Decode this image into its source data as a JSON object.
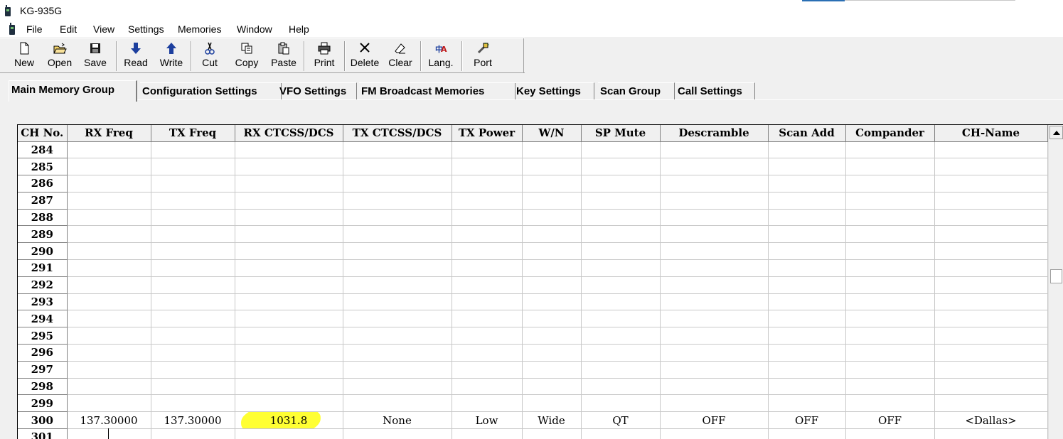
{
  "window": {
    "title": "KG-935G"
  },
  "menu": [
    "File",
    "Edit",
    "View",
    "Settings",
    "Memories",
    "Window",
    "Help"
  ],
  "toolbar": [
    {
      "label": "New",
      "icon": "new-file-icon"
    },
    {
      "label": "Open",
      "icon": "open-folder-icon"
    },
    {
      "label": "Save",
      "icon": "floppy-disk-icon"
    },
    {
      "label": "Read",
      "icon": "arrow-down-icon"
    },
    {
      "label": "Write",
      "icon": "arrow-up-icon"
    },
    {
      "label": "Cut",
      "icon": "scissors-icon"
    },
    {
      "label": "Copy",
      "icon": "copy-icon"
    },
    {
      "label": "Paste",
      "icon": "clipboard-icon"
    },
    {
      "label": "Print",
      "icon": "printer-icon"
    },
    {
      "label": "Delete",
      "icon": "x-icon"
    },
    {
      "label": "Clear",
      "icon": "eraser-icon"
    },
    {
      "label": "Lang.",
      "icon": "language-icon"
    },
    {
      "label": "Port",
      "icon": "port-icon"
    }
  ],
  "tabs": [
    {
      "label": "Main Memory Group",
      "active": true
    },
    {
      "label": "Configuration Settings"
    },
    {
      "label": "VFO Settings"
    },
    {
      "label": "FM Broadcast Memories"
    },
    {
      "label": "Key Settings"
    },
    {
      "label": "Scan Group"
    },
    {
      "label": "Call Settings"
    }
  ],
  "grid": {
    "columns": [
      "CH No.",
      "RX Freq",
      "TX Freq",
      "RX CTCSS/DCS",
      "TX CTCSS/DCS",
      "TX Power",
      "W/N",
      "SP Mute",
      "Descramble",
      "Scan Add",
      "Compander",
      "CH-Name"
    ],
    "rows": [
      [
        "284",
        "",
        "",
        "",
        "",
        "",
        "",
        "",
        "",
        "",
        "",
        ""
      ],
      [
        "285",
        "",
        "",
        "",
        "",
        "",
        "",
        "",
        "",
        "",
        "",
        ""
      ],
      [
        "286",
        "",
        "",
        "",
        "",
        "",
        "",
        "",
        "",
        "",
        "",
        ""
      ],
      [
        "287",
        "",
        "",
        "",
        "",
        "",
        "",
        "",
        "",
        "",
        "",
        ""
      ],
      [
        "288",
        "",
        "",
        "",
        "",
        "",
        "",
        "",
        "",
        "",
        "",
        ""
      ],
      [
        "289",
        "",
        "",
        "",
        "",
        "",
        "",
        "",
        "",
        "",
        "",
        ""
      ],
      [
        "290",
        "",
        "",
        "",
        "",
        "",
        "",
        "",
        "",
        "",
        "",
        ""
      ],
      [
        "291",
        "",
        "",
        "",
        "",
        "",
        "",
        "",
        "",
        "",
        "",
        ""
      ],
      [
        "292",
        "",
        "",
        "",
        "",
        "",
        "",
        "",
        "",
        "",
        "",
        ""
      ],
      [
        "293",
        "",
        "",
        "",
        "",
        "",
        "",
        "",
        "",
        "",
        "",
        ""
      ],
      [
        "294",
        "",
        "",
        "",
        "",
        "",
        "",
        "",
        "",
        "",
        "",
        ""
      ],
      [
        "295",
        "",
        "",
        "",
        "",
        "",
        "",
        "",
        "",
        "",
        "",
        ""
      ],
      [
        "296",
        "",
        "",
        "",
        "",
        "",
        "",
        "",
        "",
        "",
        "",
        ""
      ],
      [
        "297",
        "",
        "",
        "",
        "",
        "",
        "",
        "",
        "",
        "",
        "",
        ""
      ],
      [
        "298",
        "",
        "",
        "",
        "",
        "",
        "",
        "",
        "",
        "",
        "",
        ""
      ],
      [
        "299",
        "",
        "",
        "",
        "",
        "",
        "",
        "",
        "",
        "",
        "",
        ""
      ],
      [
        "300",
        "137.30000",
        "137.30000",
        "1031.8",
        "None",
        "Low",
        "Wide",
        "QT",
        "OFF",
        "OFF",
        "OFF",
        "<Dallas>"
      ],
      [
        "301",
        "",
        "",
        "",
        "",
        "",
        "",
        "",
        "",
        "",
        "",
        ""
      ]
    ],
    "highlight_color": "#ffff33"
  }
}
